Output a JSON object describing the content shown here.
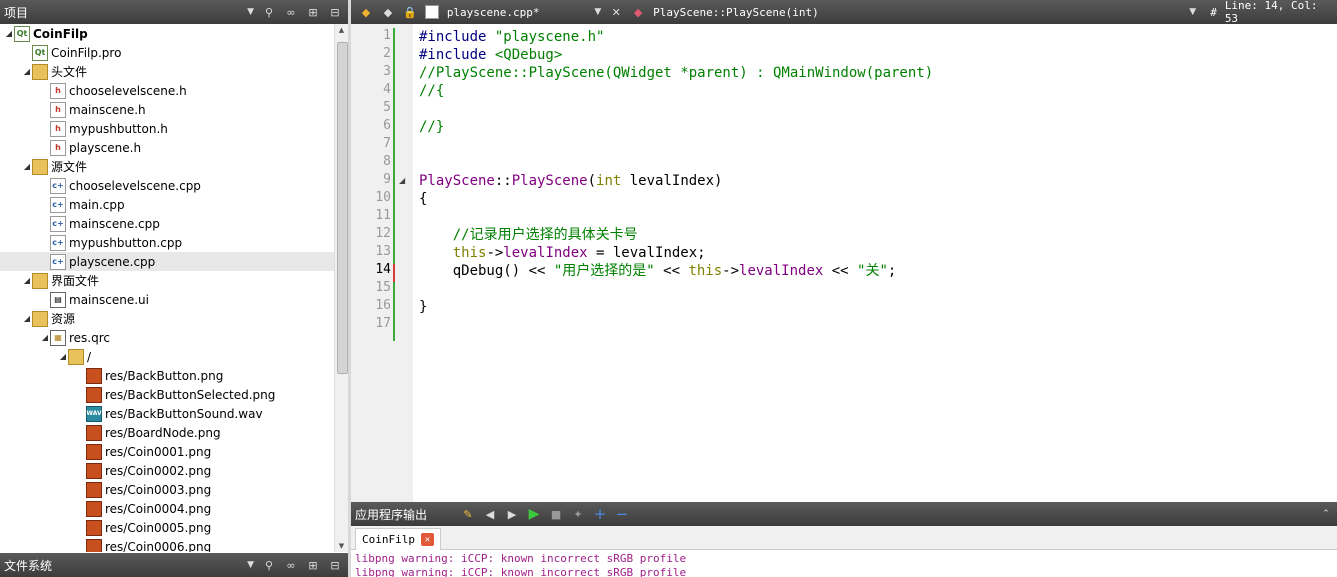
{
  "project_panel": {
    "title": "项目",
    "tree": [
      {
        "label": "CoinFilp",
        "icon": "pro-icon",
        "depth": 0,
        "expanded": true,
        "bold": true
      },
      {
        "label": "CoinFilp.pro",
        "icon": "pro-file-icon",
        "depth": 1
      },
      {
        "label": "头文件",
        "icon": "header-folder-icon",
        "depth": 1,
        "expanded": true
      },
      {
        "label": "chooselevelscene.h",
        "icon": "header-file-icon",
        "depth": 2
      },
      {
        "label": "mainscene.h",
        "icon": "header-file-icon",
        "depth": 2
      },
      {
        "label": "mypushbutton.h",
        "icon": "header-file-icon",
        "depth": 2
      },
      {
        "label": "playscene.h",
        "icon": "header-file-icon",
        "depth": 2
      },
      {
        "label": "源文件",
        "icon": "source-folder-icon",
        "depth": 1,
        "expanded": true
      },
      {
        "label": "chooselevelscene.cpp",
        "icon": "cpp-file-icon",
        "depth": 2
      },
      {
        "label": "main.cpp",
        "icon": "cpp-file-icon",
        "depth": 2
      },
      {
        "label": "mainscene.cpp",
        "icon": "cpp-file-icon",
        "depth": 2
      },
      {
        "label": "mypushbutton.cpp",
        "icon": "cpp-file-icon",
        "depth": 2
      },
      {
        "label": "playscene.cpp",
        "icon": "cpp-file-icon",
        "depth": 2,
        "selected": true
      },
      {
        "label": "界面文件",
        "icon": "forms-folder-icon",
        "depth": 1,
        "expanded": true
      },
      {
        "label": "mainscene.ui",
        "icon": "ui-file-icon",
        "depth": 2
      },
      {
        "label": "资源",
        "icon": "resource-folder-icon",
        "depth": 1,
        "expanded": true
      },
      {
        "label": "res.qrc",
        "icon": "qrc-file-icon",
        "depth": 2,
        "expanded": true
      },
      {
        "label": "/",
        "icon": "folder-icon",
        "depth": 3,
        "expanded": true
      },
      {
        "label": "res/BackButton.png",
        "icon": "image-file-icon",
        "depth": 4
      },
      {
        "label": "res/BackButtonSelected.png",
        "icon": "image-file-icon",
        "depth": 4
      },
      {
        "label": "res/BackButtonSound.wav",
        "icon": "wav-file-icon",
        "depth": 4
      },
      {
        "label": "res/BoardNode.png",
        "icon": "image-file-icon",
        "depth": 4
      },
      {
        "label": "res/Coin0001.png",
        "icon": "image-file-icon",
        "depth": 4
      },
      {
        "label": "res/Coin0002.png",
        "icon": "image-file-icon",
        "depth": 4
      },
      {
        "label": "res/Coin0003.png",
        "icon": "image-file-icon",
        "depth": 4
      },
      {
        "label": "res/Coin0004.png",
        "icon": "image-file-icon",
        "depth": 4
      },
      {
        "label": "res/Coin0005.png",
        "icon": "image-file-icon",
        "depth": 4
      },
      {
        "label": "res/Coin0006.png",
        "icon": "image-file-icon",
        "depth": 4
      }
    ]
  },
  "filesystem_panel": {
    "title": "文件系统"
  },
  "editor": {
    "file_tab": "playscene.cpp*",
    "symbol": "PlayScene::PlayScene(int)",
    "hash": "#",
    "position": "Line: 14, Col: 53",
    "current_line": 14,
    "lines": [
      [
        {
          "t": "#include ",
          "c": "pp"
        },
        {
          "t": "\"playscene.h\"",
          "c": "str"
        }
      ],
      [
        {
          "t": "#include ",
          "c": "pp"
        },
        {
          "t": "<QDebug>",
          "c": "str"
        }
      ],
      [
        {
          "t": "//PlayScene::PlayScene(QWidget *parent) : QMainWindow(parent)",
          "c": "cm"
        }
      ],
      [
        {
          "t": "//{",
          "c": "cm"
        }
      ],
      [],
      [
        {
          "t": "//}",
          "c": "cm"
        }
      ],
      [],
      [],
      [
        {
          "t": "PlayScene",
          "c": "fn"
        },
        {
          "t": "::",
          "c": ""
        },
        {
          "t": "PlayScene",
          "c": "fn"
        },
        {
          "t": "(",
          "c": ""
        },
        {
          "t": "int",
          "c": "kw"
        },
        {
          "t": " levalIndex)",
          "c": ""
        }
      ],
      [
        {
          "t": "{",
          "c": ""
        }
      ],
      [],
      [
        {
          "t": "    //记录用户选择的具体关卡号",
          "c": "cm"
        }
      ],
      [
        {
          "t": "    ",
          "c": ""
        },
        {
          "t": "this",
          "c": "kw"
        },
        {
          "t": "->",
          "c": ""
        },
        {
          "t": "levalIndex",
          "c": "fn"
        },
        {
          "t": " = levalIndex;",
          "c": ""
        }
      ],
      [
        {
          "t": "    qDebug() << ",
          "c": ""
        },
        {
          "t": "\"用户选择的是\"",
          "c": "str"
        },
        {
          "t": " << ",
          "c": ""
        },
        {
          "t": "this",
          "c": "kw"
        },
        {
          "t": "->",
          "c": ""
        },
        {
          "t": "levalIndex",
          "c": "fn"
        },
        {
          "t": " << ",
          "c": ""
        },
        {
          "t": "\"关\"",
          "c": "str"
        },
        {
          "t": ";",
          "c": ""
        }
      ],
      [],
      [
        {
          "t": "}",
          "c": ""
        }
      ],
      []
    ]
  },
  "output_panel": {
    "title": "应用程序输出",
    "tab_label": "CoinFilp",
    "lines": [
      "libpng warning: iCCP: known incorrect sRGB profile",
      "libpng warning: iCCP: known incorrect sRGB profile"
    ]
  }
}
